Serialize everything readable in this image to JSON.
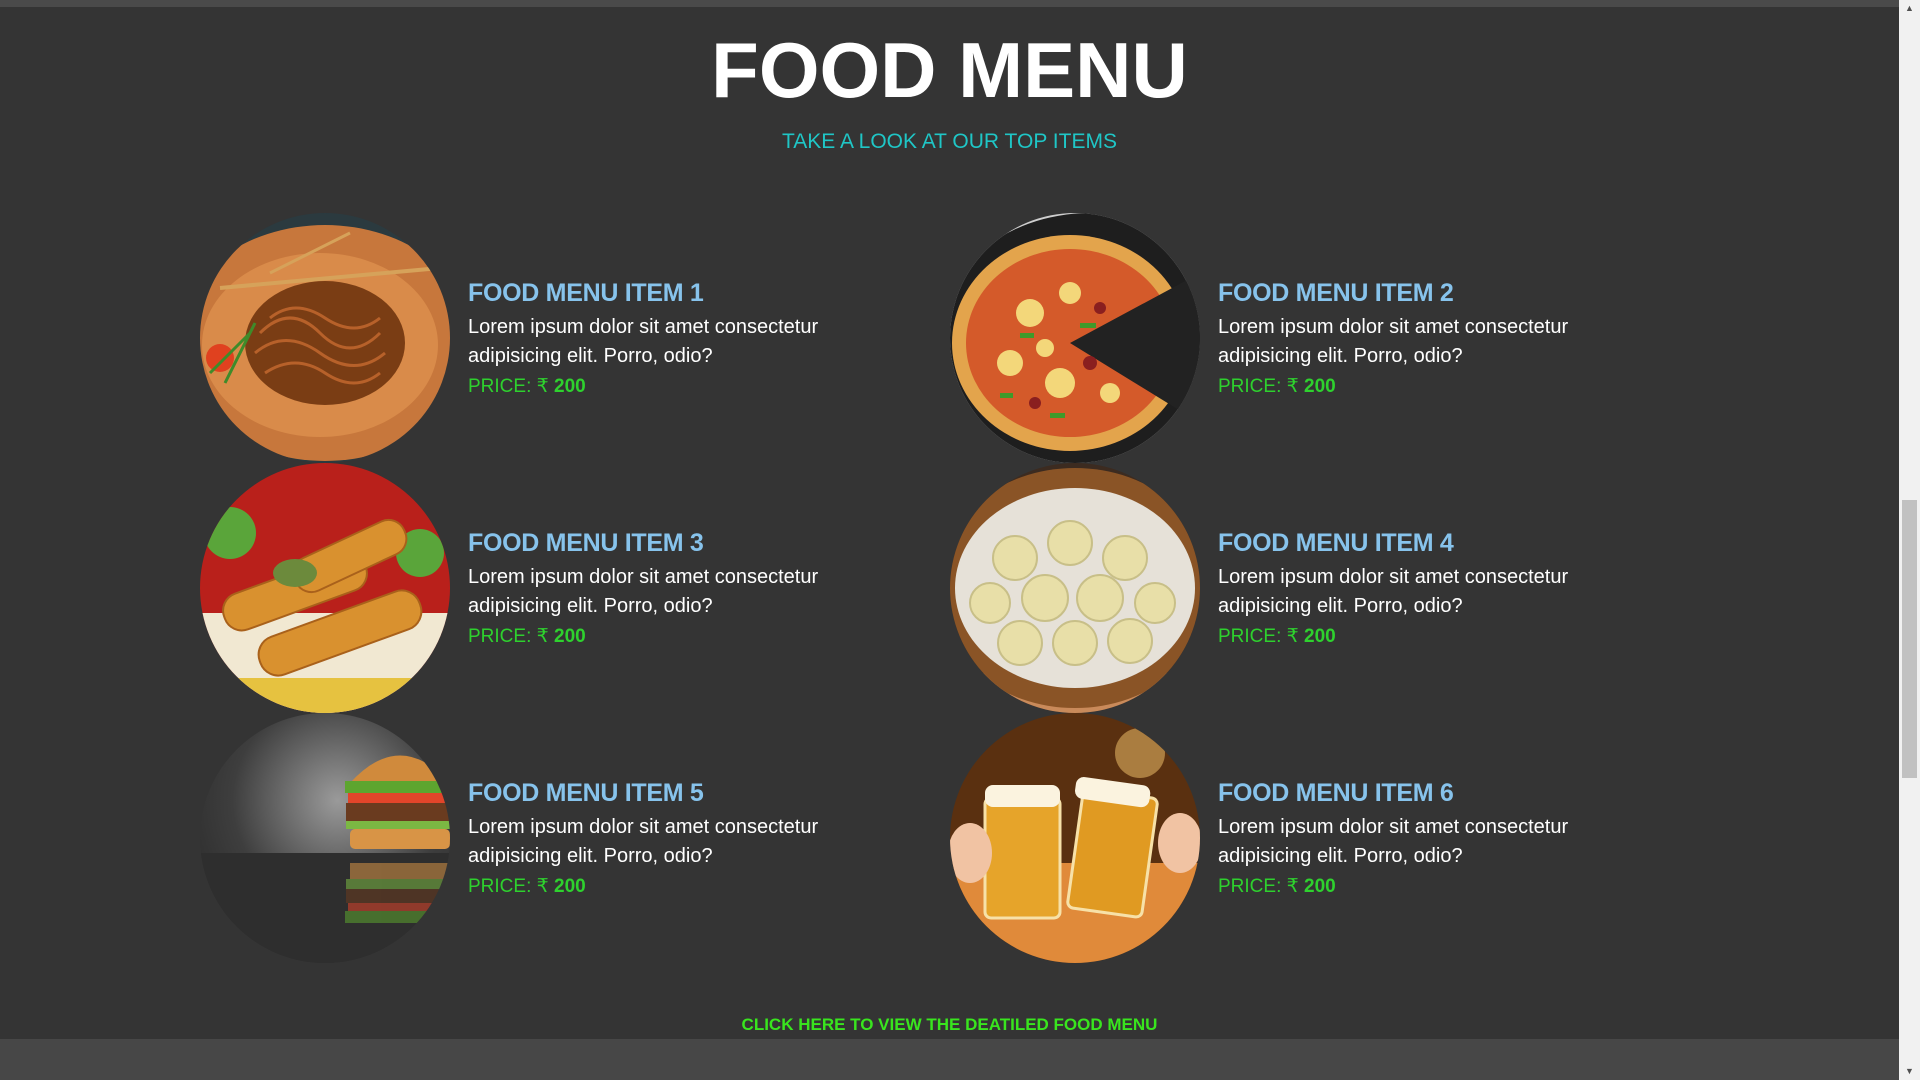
{
  "header": {
    "title": "FOOD MENU",
    "subtitle": "TAKE A LOOK AT OUR TOP ITEMS"
  },
  "items": [
    {
      "name": "FOOD MENU ITEM 1",
      "description": "Lorem ipsum dolor sit amet consectetur adipisicing elit. Porro, odio?",
      "price_label": "PRICE: ₹ ",
      "price": "200",
      "image": "noodles-image"
    },
    {
      "name": "FOOD MENU ITEM 2",
      "description": "Lorem ipsum dolor sit amet consectetur adipisicing elit. Porro, odio?",
      "price_label": "PRICE: ₹ ",
      "price": "200",
      "image": "pizza-image"
    },
    {
      "name": "FOOD MENU ITEM 3",
      "description": "Lorem ipsum dolor sit amet consectetur adipisicing elit. Porro, odio?",
      "price_label": "PRICE: ₹ ",
      "price": "200",
      "image": "spring-rolls-image"
    },
    {
      "name": "FOOD MENU ITEM 4",
      "description": "Lorem ipsum dolor sit amet consectetur adipisicing elit. Porro, odio?",
      "price_label": "PRICE: ₹ ",
      "price": "200",
      "image": "dumplings-image"
    },
    {
      "name": "FOOD MENU ITEM 5",
      "description": "Lorem ipsum dolor sit amet consectetur adipisicing elit. Porro, odio?",
      "price_label": "PRICE: ₹ ",
      "price": "200",
      "image": "burger-image"
    },
    {
      "name": "FOOD MENU ITEM 6",
      "description": "Lorem ipsum dolor sit amet consectetur adipisicing elit. Porro, odio?",
      "price_label": "PRICE: ₹ ",
      "price": "200",
      "image": "beer-image"
    }
  ],
  "cta": {
    "label": "CLICK HERE TO VIEW THE DEATILED FOOD MENU"
  },
  "colors": {
    "background": "#343434",
    "title": "#ffffff",
    "subtitle": "#1fc6c6",
    "item_name": "#87c3ec",
    "price": "#2ed12e",
    "cta": "#39e51e"
  }
}
